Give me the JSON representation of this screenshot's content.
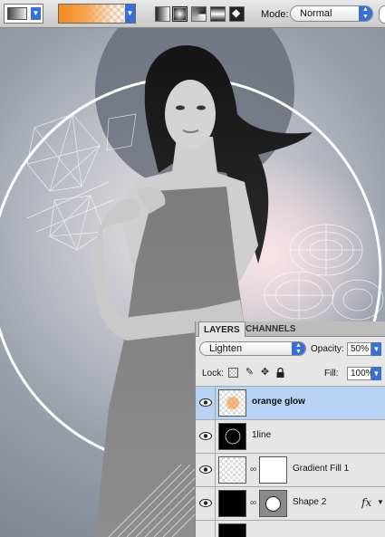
{
  "toolbar": {
    "gradient_type_icons": [
      "linear-gradient-icon",
      "radial-gradient-icon",
      "angle-gradient-icon",
      "reflected-gradient-icon",
      "diamond-gradient-icon"
    ],
    "mode_label": "Mode:",
    "mode_value": "Normal",
    "gradient_colors": [
      "#f58a1f",
      "transparent"
    ]
  },
  "layers_panel": {
    "tabs": [
      {
        "label": "LAYERS"
      },
      {
        "label": "CHANNELS"
      }
    ],
    "blend_mode": "Lighten",
    "opacity_label": "Opacity:",
    "opacity_value": "50%",
    "lock_label": "Lock:",
    "fill_label": "Fill:",
    "fill_value": "100%",
    "layers": [
      {
        "name": "orange glow",
        "selected": true
      },
      {
        "name": "1line",
        "selected": false
      },
      {
        "name": "Gradient Fill 1",
        "selected": false
      },
      {
        "name": "Shape 2",
        "selected": false,
        "fx": "fx"
      }
    ]
  }
}
